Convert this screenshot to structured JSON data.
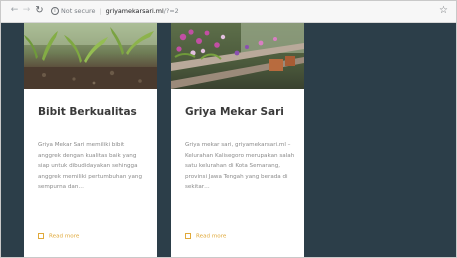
{
  "browser": {
    "security_label": "Not secure",
    "host": "griyamekarsari.ml",
    "path": "/?=2"
  },
  "icons": {
    "back": "arrow-left-icon",
    "forward": "arrow-right-icon",
    "reload": "reload-icon",
    "info": "info-icon",
    "bookmark": "star-icon",
    "read_more": "square-icon"
  },
  "colors": {
    "page_background": "#2c3e49",
    "card_background": "#ffffff",
    "read_more_accent": "#e0a93a"
  },
  "cards": [
    {
      "title": "Bibit Berkualitas",
      "text": "Griya Mekar Sari memiliki bibit anggrek dengan kualitas baik yang siap untuk dibudidayakan sehingga anggrek memiliki pertumbuhan yang sempurna dan…",
      "link": "Read more"
    },
    {
      "title": "Griya Mekar Sari",
      "text": "Griya mekar sari, griyamekarsari.ml – Kelurahan Kalisegoro merupakan salah satu kelurahan di Kota Semarang, provinsi Jawa Tengah yang berada di sekitar…",
      "link": "Read more"
    }
  ]
}
